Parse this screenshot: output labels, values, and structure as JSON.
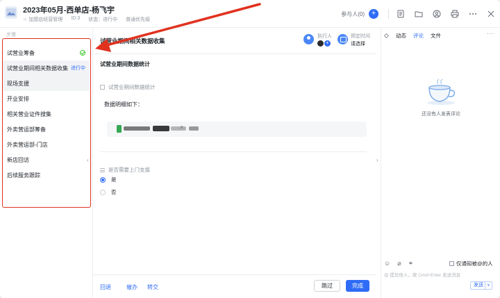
{
  "header": {
    "title": "2023年05月-西单店-杨飞宇",
    "project": "加盟店经营管理",
    "id_label": "ID:3",
    "status": "状态：进行中",
    "priority": "普通优先级",
    "participants": "参与人(0)",
    "add_symbol": "+"
  },
  "left_panel": {
    "title": "步骤",
    "steps": [
      {
        "label": "试营业筹备",
        "tag": ""
      },
      {
        "label": "试营业期间相关数据收集",
        "tag": "进行中"
      },
      {
        "label": "现场支援",
        "tag": ""
      },
      {
        "label": "开业安排",
        "tag": ""
      },
      {
        "label": "相关营业证件搜集",
        "tag": ""
      },
      {
        "label": "外卖营运部筹备",
        "tag": ""
      },
      {
        "label": "外卖营运部-门店",
        "tag": ""
      },
      {
        "label": "新店回访",
        "tag": ""
      },
      {
        "label": "后续服务跟踪",
        "tag": ""
      }
    ],
    "collapse": "‹"
  },
  "main": {
    "task_title": "试营业期间相关数据收集",
    "assignee_label": "执行人",
    "add_symbol": "+",
    "due_label": "预定时间",
    "due_value": "请选择",
    "section_title": "试营业期间数据统计",
    "field1_label": "试营业期间数据统计",
    "rich_text": "数据明细如下：",
    "attachment_ext": ".x",
    "field2_label": "是否需要上门支援",
    "options": [
      {
        "label": "是",
        "selected": true
      },
      {
        "label": "否",
        "selected": false
      }
    ],
    "footer": {
      "rollback": "回退",
      "urge": "催办",
      "transfer": "转交",
      "skip": "跳过",
      "complete": "完成"
    }
  },
  "right_panel": {
    "tabs": [
      "动态",
      "评论",
      "文件"
    ],
    "active_tab": "评论",
    "empty_text": "还没有人发表评论",
    "notify_label": "仅通知被@的人",
    "input_placeholder": "@ 提及他人，按 Cmd+Enter 发送消息",
    "send_label": "发送",
    "dropdown": "∨",
    "collapse": "›"
  },
  "colors": {
    "accent": "#2f6cf6",
    "highlight_border": "#e0321f",
    "done_green": "#34c724"
  }
}
